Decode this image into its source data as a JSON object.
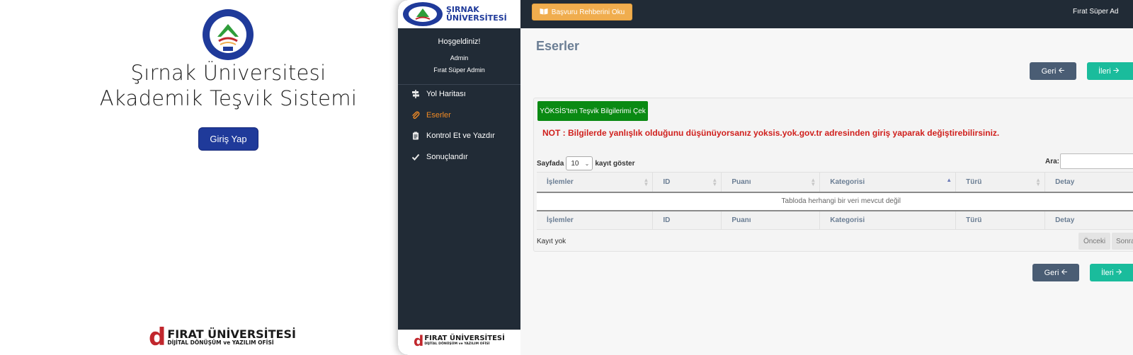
{
  "login": {
    "title_line1": "Şırnak Üniversitesi",
    "title_line2": "Akademik Teşvik Sistemi",
    "login_button": "Giriş Yap",
    "seal_text": "T.C. ŞIRNAK ÜNİVERSİTESİ",
    "seal_year": "2008"
  },
  "footer_logo": {
    "name": "FIRAT ÜNİVERSİTESİ",
    "subtitle": "DİJİTAL DÖNÜŞÜM ve YAZILIM OFİSİ"
  },
  "brand": {
    "line1": "ŞIRNAK",
    "line2": "ÜNİVERSİTESİ"
  },
  "sidebar": {
    "welcome": "Hoşgeldiniz!",
    "role": "Admin",
    "user": "Fırat Süper Admin",
    "items": [
      {
        "label": "Yol Haritası",
        "icon": "signpost-icon",
        "active": false
      },
      {
        "label": "Eserler",
        "icon": "paperclip-icon",
        "active": true
      },
      {
        "label": "Kontrol Et ve Yazdır",
        "icon": "clipboard-icon",
        "active": false
      },
      {
        "label": "Sonuçlandır",
        "icon": "check-icon",
        "active": false
      }
    ]
  },
  "topbar": {
    "guide_button": "Başvuru Rehberini Oku",
    "user_name": "Fırat Süper Ad"
  },
  "main": {
    "title": "Eserler",
    "back_button": "Geri",
    "next_button": "İleri",
    "yoksis_button": "YÖKSİS'ten Teşvik Bilgilerimi Çek",
    "note": "NOT : Bilgilerde yanlışlık olduğunu düşünüyorsanız yoksis.yok.gov.tr adresinden giriş yaparak değiştirebilirsiniz.",
    "length_prefix": "Sayfada",
    "length_value": "10",
    "length_suffix": "kayıt göster",
    "search_label": "Ara:",
    "columns": [
      "İşlemler",
      "ID",
      "Puanı",
      "Kategorisi",
      "Türü",
      "Detay"
    ],
    "empty_message": "Tabloda herhangi bir veri mevcut değil",
    "info": "Kayıt yok",
    "prev_button": "Önceki",
    "next_page_button": "Sonraki"
  },
  "colors": {
    "sidebar_bg": "#212b36",
    "accent_orange": "#f08a24",
    "warning_button": "#f0ad4e",
    "success_green": "#0a8a13",
    "teal": "#1abc9c",
    "slate": "#4a5d74",
    "note_red": "#d0201d",
    "login_blue": "#1f3a9a"
  }
}
